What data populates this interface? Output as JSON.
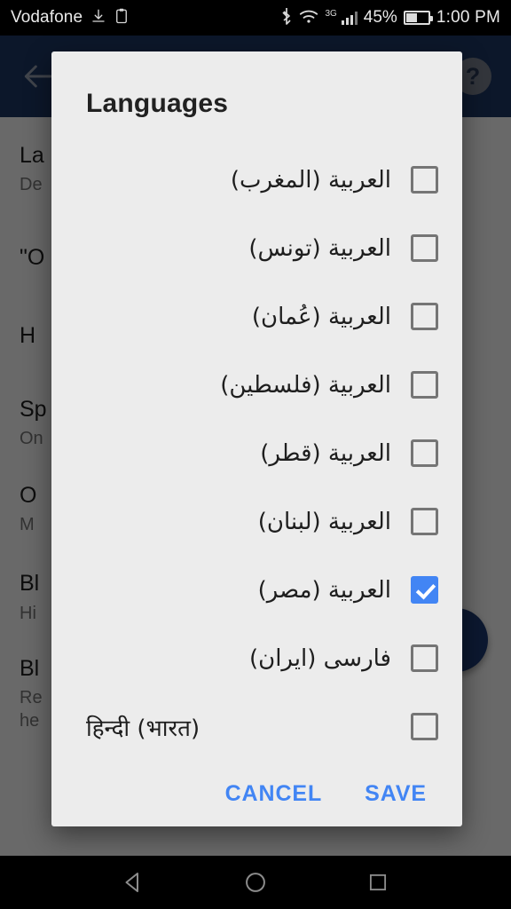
{
  "status_bar": {
    "carrier": "Vodafone",
    "download_icon": "download-icon",
    "sync_icon": "clipboard-icon",
    "bluetooth_icon": "bluetooth-icon",
    "wifi_icon": "wifi-icon",
    "network_type": "3G",
    "signal_icon": "signal-bars-icon",
    "battery_percent": "45%",
    "battery_icon": "battery-icon",
    "time": "1:00 PM"
  },
  "app_bar": {
    "back_label": "back-arrow",
    "help_label": "?",
    "background_color": "#1e3864"
  },
  "background_list": [
    {
      "title": "La",
      "subtitle": "De"
    },
    {
      "title": "\"O",
      "subtitle": ""
    },
    {
      "title": "H",
      "subtitle": ""
    },
    {
      "title": "Sp",
      "subtitle": "On"
    },
    {
      "title": "O",
      "subtitle": "M"
    },
    {
      "title": "Bl",
      "subtitle": "Hi"
    },
    {
      "title": "Bl",
      "subtitle": "Re\nhe"
    }
  ],
  "dialog": {
    "title": "Languages",
    "accent_color": "#4285f4",
    "languages": [
      {
        "label": "العربية (المغرب)",
        "checked": false,
        "dir": "rtl"
      },
      {
        "label": "العربية (تونس)",
        "checked": false,
        "dir": "rtl"
      },
      {
        "label": "العربية (عُمان)",
        "checked": false,
        "dir": "rtl"
      },
      {
        "label": "العربية (فلسطين)",
        "checked": false,
        "dir": "rtl"
      },
      {
        "label": "العربية (قطر)",
        "checked": false,
        "dir": "rtl"
      },
      {
        "label": "العربية (لبنان)",
        "checked": false,
        "dir": "rtl"
      },
      {
        "label": "العربية (مصر)",
        "checked": true,
        "dir": "rtl"
      },
      {
        "label": "فارسى (ايران)",
        "checked": false,
        "dir": "rtl"
      },
      {
        "label": "हिन्दी (भारत)",
        "checked": false,
        "dir": "ltr"
      }
    ],
    "cancel_label": "CANCEL",
    "save_label": "SAVE"
  },
  "nav_bar": {
    "back": "nav-back-icon",
    "home": "nav-home-icon",
    "recents": "nav-recents-icon"
  }
}
